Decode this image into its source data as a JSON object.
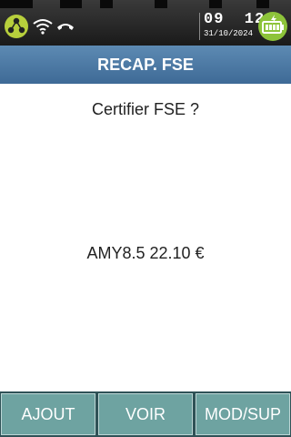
{
  "status_bar": {
    "icons": [
      "network-icon",
      "wifi-icon",
      "phone-hangup-icon",
      "battery-charging-icon"
    ],
    "time": "09  12",
    "date": "31/10/2024"
  },
  "title": "RECAP. FSE",
  "question": "Certifier FSE ?",
  "amount_line": "AMY8.5 22.10 €",
  "buttons": {
    "left": "AJOUT",
    "middle": "VOIR",
    "right": "MOD/SUP"
  },
  "colors": {
    "status_bar": "#2a2a2a",
    "title_bar": "#4a77a3",
    "button_bg": "#6ea3a1",
    "battery": "#8dc33a"
  }
}
